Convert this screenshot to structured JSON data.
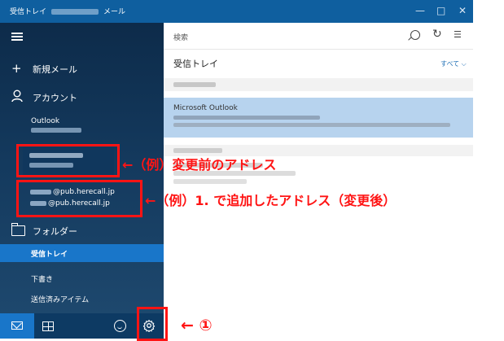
{
  "window": {
    "title_left": "受信トレイ",
    "title_right": "メール",
    "minimize": "—",
    "maximize": "□",
    "close": "✕"
  },
  "sidebar": {
    "new_mail": "新規メール",
    "accounts": "アカウント",
    "account_outlook": "Outlook",
    "new_account_email_1": "@pub.herecall.jp",
    "new_account_email_2": "@pub.herecall.jp",
    "folders": "フォルダー",
    "folder_items": [
      {
        "label": "受信トレイ",
        "selected": true
      },
      {
        "label": "下書き",
        "selected": false
      },
      {
        "label": "送信済みアイテム",
        "selected": false
      }
    ]
  },
  "pane": {
    "search_placeholder": "検索",
    "inbox_title": "受信トレイ",
    "filter": "すべて ⌵",
    "selected_message_sender": "Microsoft Outlook"
  },
  "annotations": {
    "before_label": "←（例）変更前のアドレス",
    "after_label": "←（例）1. で追加したアドレス（変更後）",
    "gear_label": "← ①"
  },
  "colors": {
    "accent": "#1976c9",
    "titlebar": "#0f5f9f",
    "annotation_red": "#ff1414",
    "selected_message": "#b7d3ee"
  },
  "icons": [
    "menu-icon",
    "plus-icon",
    "person-icon",
    "folder-icon",
    "mail-icon",
    "calendar-icon",
    "smiley-icon",
    "gear-icon",
    "search-icon",
    "sync-icon",
    "select-icon"
  ]
}
